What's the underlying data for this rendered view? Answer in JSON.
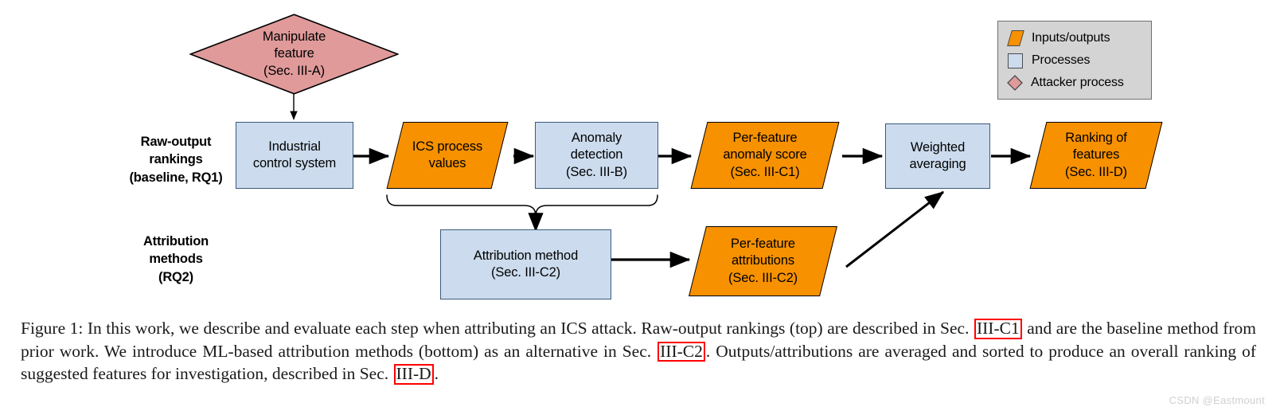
{
  "figure": {
    "watermark": "CSDN @Eastmount"
  },
  "row_labels": [
    {
      "name": "raw-output-rankings",
      "lines": [
        "Raw-output",
        "rankings",
        "(baseline, RQ1)"
      ]
    },
    {
      "name": "attribution-methods",
      "lines": [
        "Attribution",
        "methods",
        "(RQ2)"
      ]
    }
  ],
  "nodes": {
    "manipulate_feature": {
      "lines": [
        "Manipulate",
        "feature",
        "(Sec. III-A)"
      ],
      "shape": "diamond",
      "role": "Attacker process"
    },
    "industrial_control_system": {
      "lines": [
        "Industrial",
        "control system"
      ],
      "shape": "rectangle",
      "role": "Processes"
    },
    "ics_process_values": {
      "lines": [
        "ICS process",
        "values"
      ],
      "shape": "parallelogram",
      "role": "Inputs/outputs"
    },
    "anomaly_detection": {
      "lines": [
        "Anomaly",
        "detection",
        "(Sec. III-B)"
      ],
      "shape": "rectangle",
      "role": "Processes"
    },
    "per_feature_anomaly_score": {
      "lines": [
        "Per-feature",
        "anomaly score",
        "(Sec. III-C1)"
      ],
      "shape": "parallelogram",
      "role": "Inputs/outputs"
    },
    "weighted_averaging": {
      "lines": [
        "Weighted",
        "averaging"
      ],
      "shape": "rectangle",
      "role": "Processes"
    },
    "ranking_of_features": {
      "lines": [
        "Ranking of",
        "features",
        "(Sec. III-D)"
      ],
      "shape": "parallelogram",
      "role": "Inputs/outputs"
    },
    "attribution_method": {
      "lines": [
        "Attribution method",
        "(Sec. III-C2)"
      ],
      "shape": "rectangle",
      "role": "Processes"
    },
    "per_feature_attributions": {
      "lines": [
        "Per-feature",
        "attributions",
        "(Sec. III-C2)"
      ],
      "shape": "parallelogram",
      "role": "Inputs/outputs"
    }
  },
  "legend": {
    "items": [
      {
        "label": "Inputs/outputs",
        "swatch": "parallelogram-orange",
        "color": "#f79100"
      },
      {
        "label": "Processes",
        "swatch": "square-lightblue",
        "color": "#ccdcee"
      },
      {
        "label": "Attacker process",
        "swatch": "diamond-pink",
        "color": "#e09a9a"
      }
    ],
    "background": "#d4d4d4"
  },
  "caption": {
    "parts": [
      {
        "type": "text",
        "value": "Figure 1: In this work, we describe and evaluate each step when attributing an ICS attack. Raw-output rankings (top) are described in Sec. "
      },
      {
        "type": "boxed",
        "value": "III-C1"
      },
      {
        "type": "text",
        "value": " and are the baseline method from prior work. We introduce ML-based attribution methods (bottom) as an alternative in Sec. "
      },
      {
        "type": "boxed",
        "value": "III-C2"
      },
      {
        "type": "text",
        "value": ". Outputs/attributions are averaged and sorted to produce an overall ranking of suggested features for investigation, described in Sec. "
      },
      {
        "type": "boxed",
        "value": "III-D"
      },
      {
        "type": "text",
        "value": "."
      }
    ],
    "highlight_color": "#ff0000"
  }
}
